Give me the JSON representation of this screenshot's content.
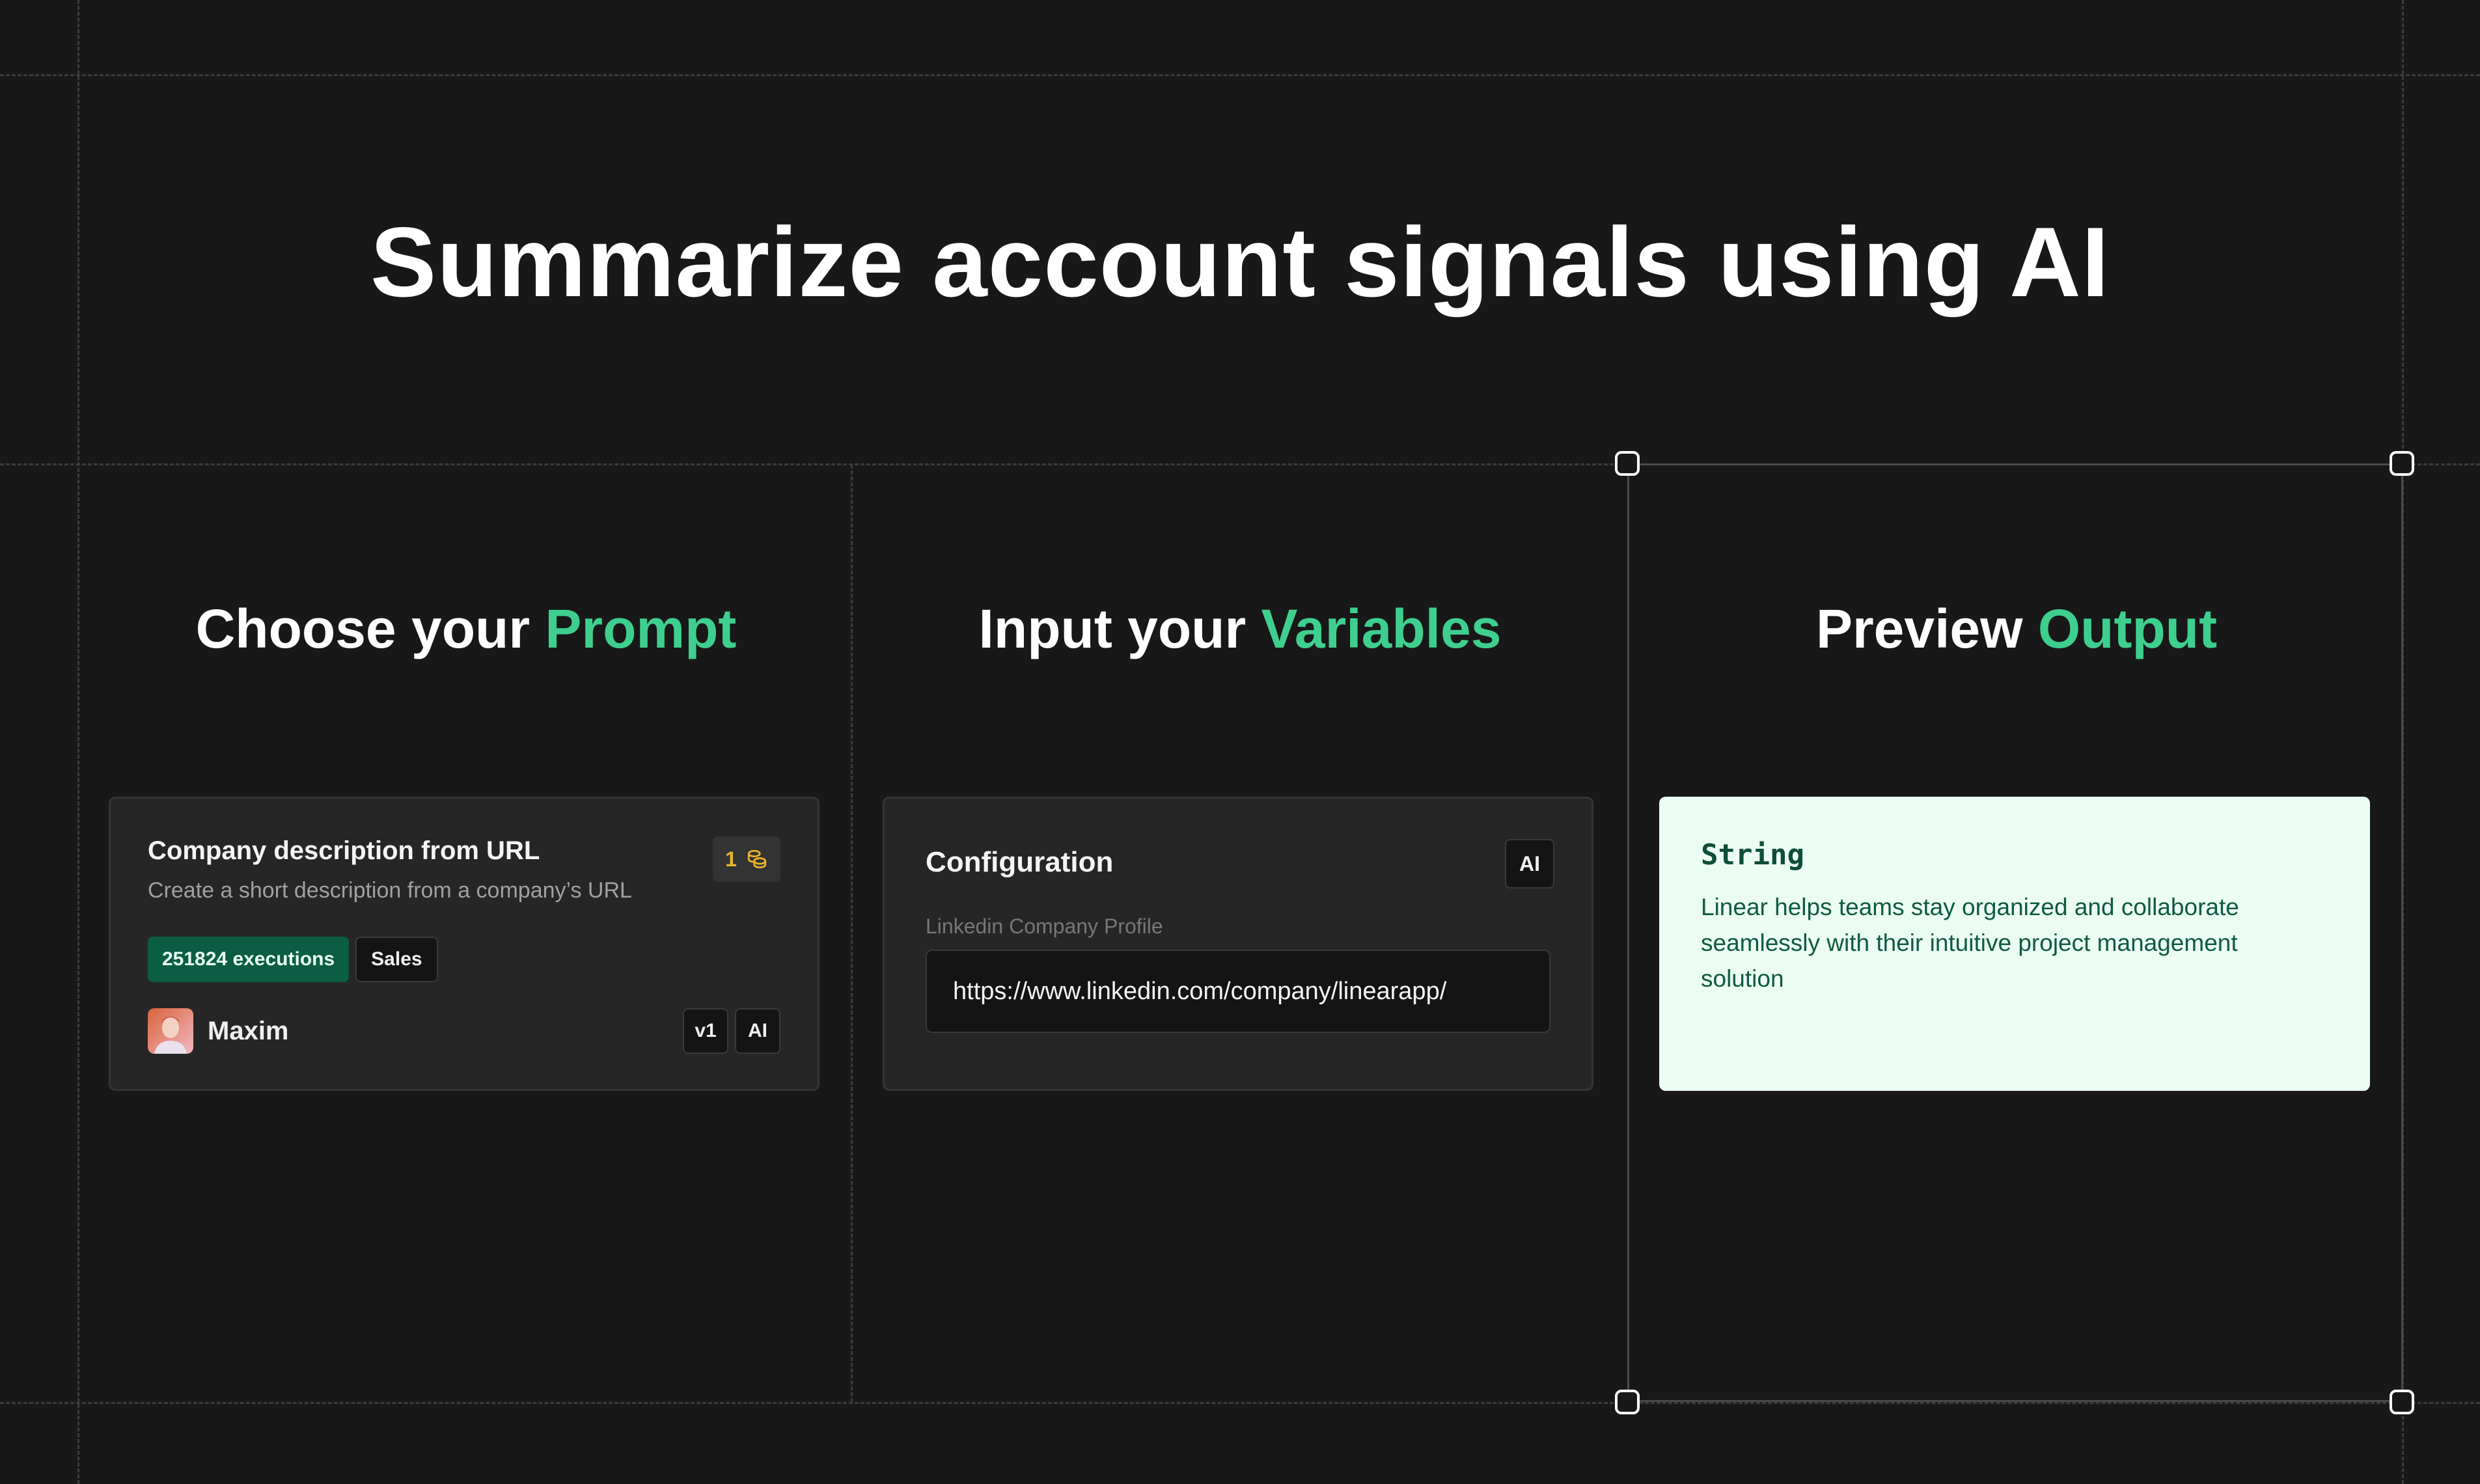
{
  "page": {
    "title": "Summarize account signals using AI"
  },
  "columns": {
    "prompt": {
      "title_prefix": "Choose your ",
      "title_accent": "Prompt"
    },
    "variables": {
      "title_prefix": "Input your ",
      "title_accent": "Variables"
    },
    "output": {
      "title_prefix": "Preview ",
      "title_accent": "Output"
    }
  },
  "prompt_card": {
    "title": "Company description from URL",
    "description": "Create a short description from a company’s URL",
    "credit_count": "1",
    "credit_icon": "coins-icon",
    "executions_label": "251824 executions",
    "category": "Sales",
    "author": "Maxim",
    "version": "v1",
    "ai_badge": "AI"
  },
  "config_card": {
    "title": "Configuration",
    "ai_badge": "AI",
    "field_label": "Linkedin Company Profile",
    "field_value": "https://www.linkedin.com/company/linearapp/"
  },
  "output_card": {
    "type_label": "String",
    "text": "Linear helps teams stay organized and collaborate seamlessly with their intuitive project management solution"
  },
  "colors": {
    "background": "#181818",
    "accent": "#3ecf8e",
    "card": "#262626",
    "output_bg": "#ebfcf3",
    "execution_badge": "#0b5d44",
    "credit": "#e8b429"
  }
}
